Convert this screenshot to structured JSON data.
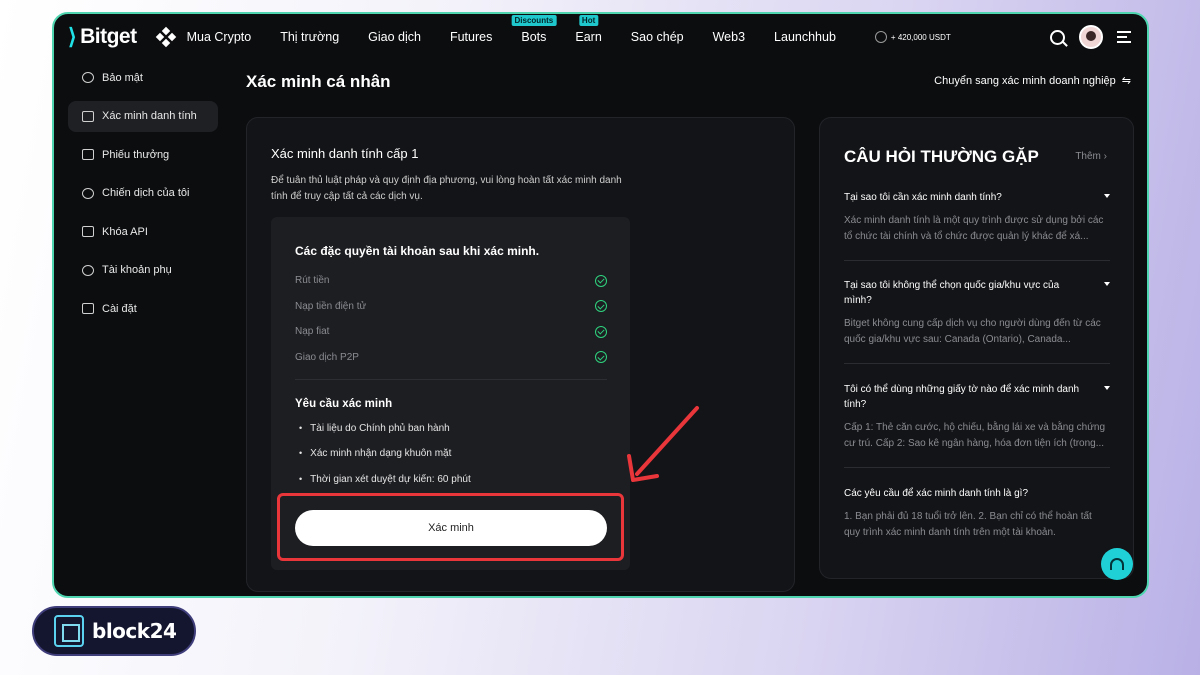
{
  "header": {
    "brand": "Bitget",
    "nav": [
      {
        "label": "Mua Crypto",
        "badge": ""
      },
      {
        "label": "Thị trường",
        "badge": ""
      },
      {
        "label": "Giao dịch",
        "badge": ""
      },
      {
        "label": "Futures",
        "badge": ""
      },
      {
        "label": "Bots",
        "badge": "Discounts"
      },
      {
        "label": "Earn",
        "badge": "Hot"
      },
      {
        "label": "Sao chép",
        "badge": ""
      },
      {
        "label": "Web3",
        "badge": ""
      },
      {
        "label": "Launchhub",
        "badge": ""
      }
    ],
    "promo": "+ 420,000 USDT"
  },
  "sidebar": {
    "items": [
      {
        "label": "Bảo mật",
        "icon": "shield-icon"
      },
      {
        "label": "Xác minh danh tính",
        "icon": "id-card-icon"
      },
      {
        "label": "Phiếu thưởng",
        "icon": "ticket-icon"
      },
      {
        "label": "Chiến dịch của tôi",
        "icon": "trophy-icon"
      },
      {
        "label": "Khóa API",
        "icon": "api-icon"
      },
      {
        "label": "Tài khoản phụ",
        "icon": "subaccount-icon"
      },
      {
        "label": "Cài đặt",
        "icon": "settings-icon"
      }
    ],
    "active_index": 1
  },
  "main": {
    "title": "Xác minh cá nhân",
    "switch_link": "Chuyển sang xác minh doanh nghiệp",
    "level": {
      "title": "Xác minh danh tính cấp 1",
      "description": "Để tuân thủ luật pháp và quy định địa phương, vui lòng hoàn tất xác minh danh tính để truy cập tất cả các dịch vụ.",
      "privileges_title": "Các đặc quyền tài khoản sau khi xác minh.",
      "privileges": [
        "Rút tiền",
        "Nạp tiền điện tử",
        "Nạp fiat",
        "Giao dịch P2P"
      ],
      "requirements_title": "Yêu cầu xác minh",
      "requirements": [
        "Tài liệu do Chính phủ ban hành",
        "Xác minh nhận dạng khuôn mặt",
        "Thời gian xét duyệt dự kiến: 60 phút"
      ],
      "button": "Xác minh"
    }
  },
  "faq": {
    "title": "CÂU HỎI THƯỜNG GẶP",
    "more": "Thêm",
    "items": [
      {
        "q": "Tại sao tôi cần xác minh danh tính?",
        "a": "Xác minh danh tính là một quy trình được sử dụng bởi các tổ chức tài chính và tổ chức được quản lý khác để xá..."
      },
      {
        "q": "Tại sao tôi không thể chọn quốc gia/khu vực của mình?",
        "a": "Bitget không cung cấp dịch vụ cho người dùng đến từ các quốc gia/khu vực sau: Canada (Ontario), Canada..."
      },
      {
        "q": "Tôi có thể dùng những giấy tờ nào để xác minh danh tính?",
        "a": "Cấp 1: Thẻ căn cước, hộ chiếu, bằng lái xe và bằng chứng cư trú. Cấp 2: Sao kê ngân hàng, hóa đơn tiện ích (trong..."
      },
      {
        "q": "Các yêu cầu để xác minh danh tính là gì?",
        "a": "1. Bạn phải đủ 18 tuổi trở lên. 2. Bạn chỉ có thể hoàn tất quy trình xác minh danh tính trên một tài khoản."
      }
    ]
  },
  "watermark": {
    "brand": "block24"
  },
  "colors": {
    "accent": "#1fc8cc",
    "highlight": "#e8363b",
    "frame_border": "#4fd6b0",
    "check": "#2fd37e"
  }
}
